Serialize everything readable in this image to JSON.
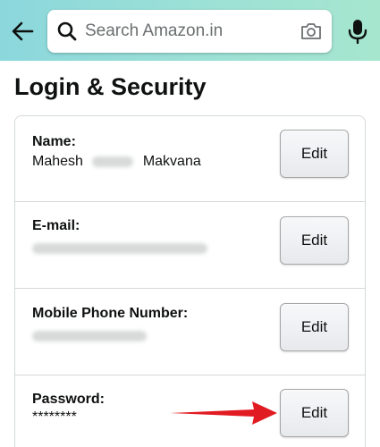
{
  "header": {
    "back_icon": "arrow-left-icon",
    "search": {
      "placeholder": "Search Amazon.in",
      "value": "",
      "search_icon": "magnifier-icon",
      "camera_icon": "camera-icon"
    },
    "mic_icon": "microphone-icon",
    "gradient_colors": [
      "#8bd7dc",
      "#a6e6cf"
    ]
  },
  "page": {
    "title": "Login & Security"
  },
  "security_items": [
    {
      "label": "Name:",
      "value_first": "Mahesh",
      "value_last": "Makvana",
      "edit_label": "Edit"
    },
    {
      "label": "E-mail:",
      "value": "",
      "edit_label": "Edit"
    },
    {
      "label": "Mobile Phone Number:",
      "value": "",
      "edit_label": "Edit"
    },
    {
      "label": "Password:",
      "value": "********",
      "edit_label": "Edit"
    }
  ],
  "annotation": {
    "arrow_color": "#e11b22",
    "arrow_target": "password-edit-button"
  }
}
